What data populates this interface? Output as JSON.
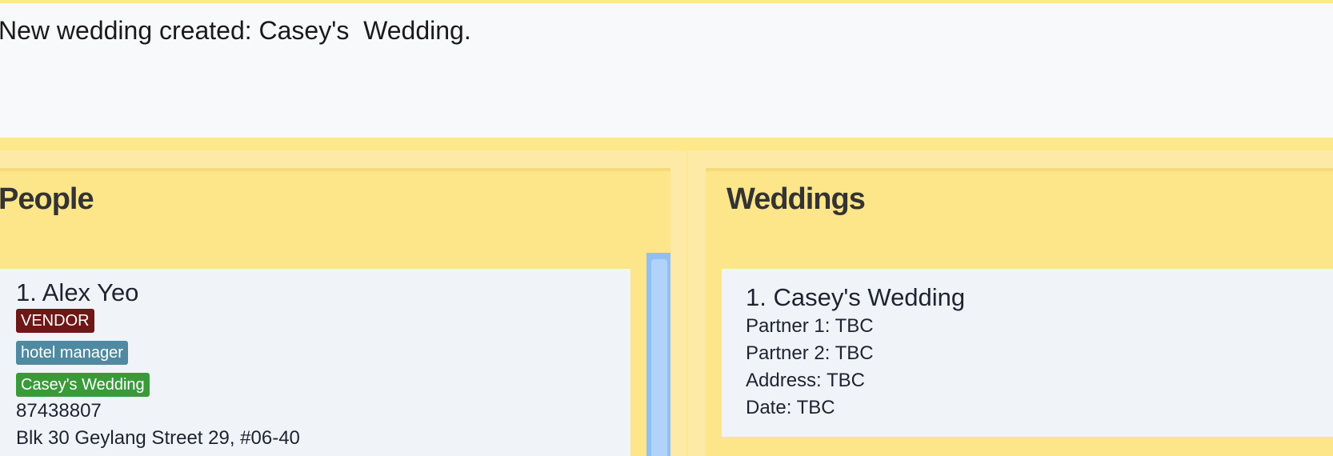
{
  "result": {
    "message": "New wedding created: Casey's  Wedding."
  },
  "people_panel": {
    "title": "People",
    "persons": [
      {
        "name": "1. Alex Yeo",
        "role_tag": "VENDOR",
        "tags": [
          "hotel manager",
          "Casey's Wedding"
        ],
        "phone": "87438807",
        "address": "Blk 30 Geylang Street 29, #06-40"
      }
    ]
  },
  "weddings_panel": {
    "title": "Weddings",
    "weddings": [
      {
        "name": "1. Casey's Wedding",
        "partner1": "Partner 1: TBC",
        "partner2": "Partner 2: TBC",
        "address": "Address: TBC",
        "date": "Date: TBC"
      }
    ]
  },
  "colors": {
    "background": "#fde88a",
    "card": "#f0f4f9",
    "vendor_tag": "#6e1717",
    "hotel_manager_tag": "#4f8aa0",
    "wedding_tag": "#3a9a3a",
    "scrollbar": "#92bff2"
  }
}
